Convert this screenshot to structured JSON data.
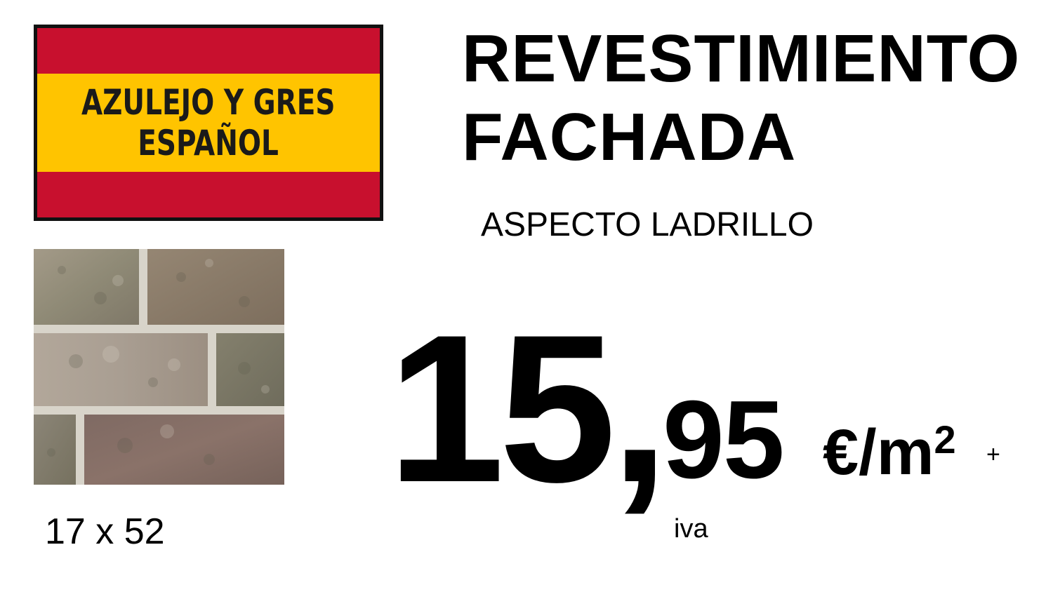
{
  "badge": {
    "line1": "AZULEJO Y GRES",
    "line2": "ESPAÑOL",
    "colors": {
      "red": "#c8102e",
      "yellow": "#ffc400",
      "border": "#111111"
    }
  },
  "product": {
    "title_line1": "REVESTIMIENTO",
    "title_line2": "FACHADA",
    "subtitle": "ASPECTO LADRILLO",
    "size": "17 x 52",
    "image_icon": "brick-tile-image"
  },
  "price": {
    "integer": "15,",
    "decimals": "95",
    "unit": "€/m",
    "unit_exponent": "2",
    "plus": "+",
    "tax": "iva"
  }
}
